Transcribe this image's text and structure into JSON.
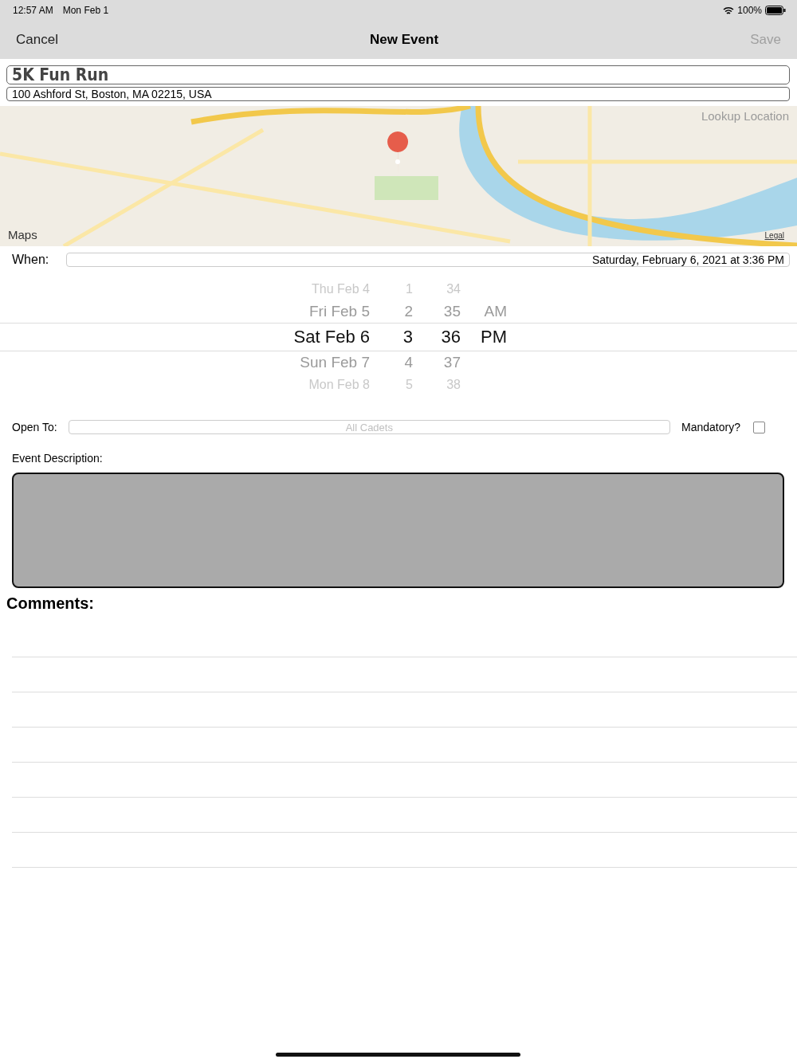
{
  "status_bar": {
    "time": "12:57 AM",
    "date": "Mon Feb 1",
    "battery": "100%"
  },
  "nav": {
    "cancel": "Cancel",
    "title": "New Event",
    "save": "Save",
    "save_disabled": true
  },
  "event": {
    "title": "5K Fun Run",
    "address": "100 Ashford St, Boston, MA 02215, USA"
  },
  "map": {
    "lookup": "Lookup Location",
    "logo": "Maps",
    "legal": "Legal"
  },
  "when": {
    "label": "When:",
    "value": "Saturday, February 6, 2021 at 3:36 PM"
  },
  "picker": [
    {
      "date": "Thu Feb 4",
      "hour": "1",
      "minute": "34",
      "selected": false
    },
    {
      "date": "Fri Feb 5",
      "hour": "2",
      "minute": "35",
      "period": "AM",
      "selected": false
    },
    {
      "date": "Sat Feb 6",
      "hour": "3",
      "minute": "36",
      "period": "PM",
      "selected": true
    },
    {
      "date": "Sun Feb 7",
      "hour": "4",
      "minute": "37",
      "selected": false
    },
    {
      "date": "Mon Feb 8",
      "hour": "5",
      "minute": "38",
      "selected": false
    }
  ],
  "open_to": {
    "label": "Open To:",
    "placeholder": "All Cadets"
  },
  "mandatory": {
    "label": "Mandatory?",
    "checked": false
  },
  "description": {
    "label": "Event Description:"
  },
  "comments": {
    "title": "Comments:"
  }
}
